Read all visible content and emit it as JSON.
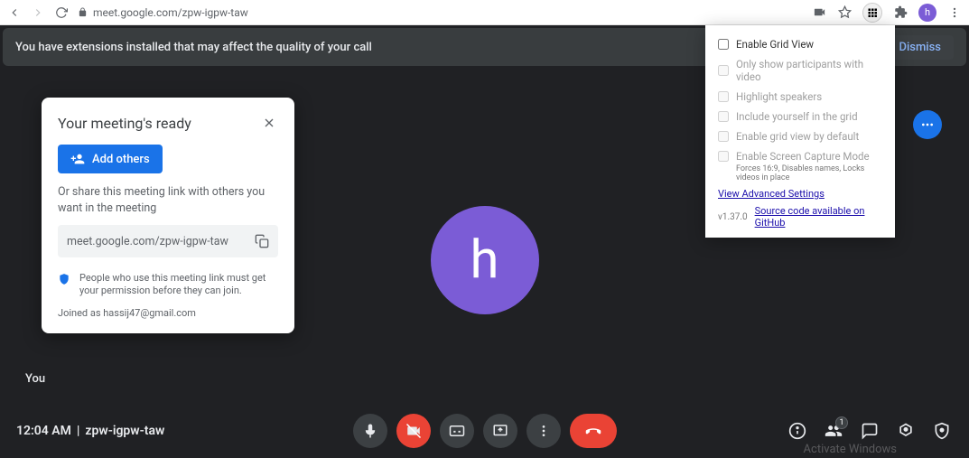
{
  "chrome": {
    "url": "meet.google.com/zpw-igpw-taw",
    "profile_letter": "h"
  },
  "banner": {
    "text": "You have extensions installed that may affect the quality of your call",
    "dismiss": "Dismiss"
  },
  "ready": {
    "title": "Your meeting's ready",
    "add_others": "Add others",
    "share_text": "Or share this meeting link with others you want in the meeting",
    "link": "meet.google.com/zpw-igpw-taw",
    "perm_text": "People who use this meeting link must get your permission before they can join.",
    "joined_as": "Joined as hassij47@gmail.com"
  },
  "ext": {
    "opt_enable": "Enable Grid View",
    "opt_only": "Only show participants with video",
    "opt_highlight": "Highlight speakers",
    "opt_include": "Include yourself in the grid",
    "opt_default": "Enable grid view by default",
    "opt_capture": "Enable Screen Capture Mode",
    "capture_sub": "Forces 16:9, Disables names, Locks videos in place",
    "advanced": "View Advanced Settings",
    "version": "v1.37.0",
    "source": "Source code available on GitHub"
  },
  "center": {
    "letter": "h",
    "you": "You"
  },
  "bottom": {
    "time": "12:04 AM",
    "code": "zpw-igpw-taw",
    "participants": "1"
  },
  "watermark": "Activate Windows"
}
